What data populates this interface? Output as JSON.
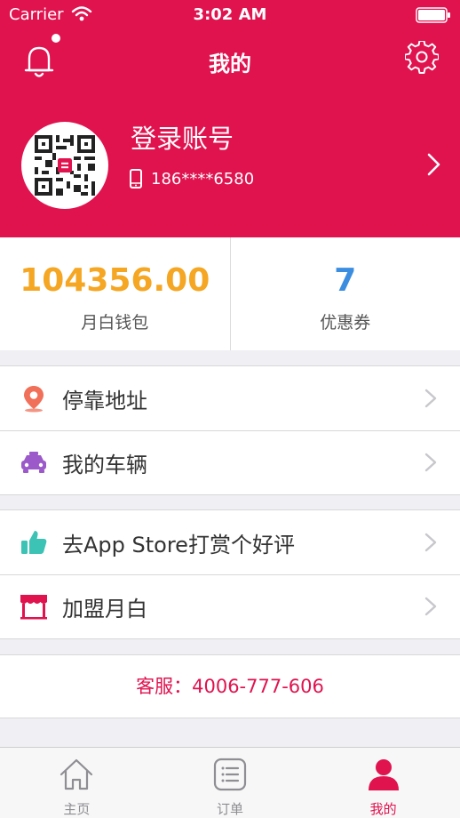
{
  "status_bar": {
    "carrier": "Carrier",
    "time": "3:02 AM"
  },
  "nav": {
    "title": "我的"
  },
  "profile": {
    "login_text": "登录账号",
    "phone": "186****6580"
  },
  "stats": [
    {
      "value": "104356.00",
      "label": "月白钱包"
    },
    {
      "value": "7",
      "label": "优惠券"
    }
  ],
  "menu": {
    "group1": [
      {
        "label": "停靠地址",
        "icon": "location-pin-icon"
      },
      {
        "label": "我的车辆",
        "icon": "car-icon"
      }
    ],
    "group2": [
      {
        "label": "去App Store打赏个好评",
        "icon": "thumbs-up-icon"
      },
      {
        "label": "加盟月白",
        "icon": "storefront-icon"
      }
    ]
  },
  "service": {
    "text": "客服：4006-777-606"
  },
  "tabbar": [
    {
      "label": "主页",
      "icon": "home-icon"
    },
    {
      "label": "订单",
      "icon": "order-list-icon"
    },
    {
      "label": "我的",
      "icon": "profile-icon"
    }
  ],
  "colors": {
    "brand": "#e0134f",
    "wallet": "#f5a623",
    "coupon": "#3b8de0",
    "location_icon": "#f0705a",
    "car_icon": "#9b59c9",
    "thumb_icon": "#3cc3b5",
    "store_icon": "#e0134f"
  }
}
